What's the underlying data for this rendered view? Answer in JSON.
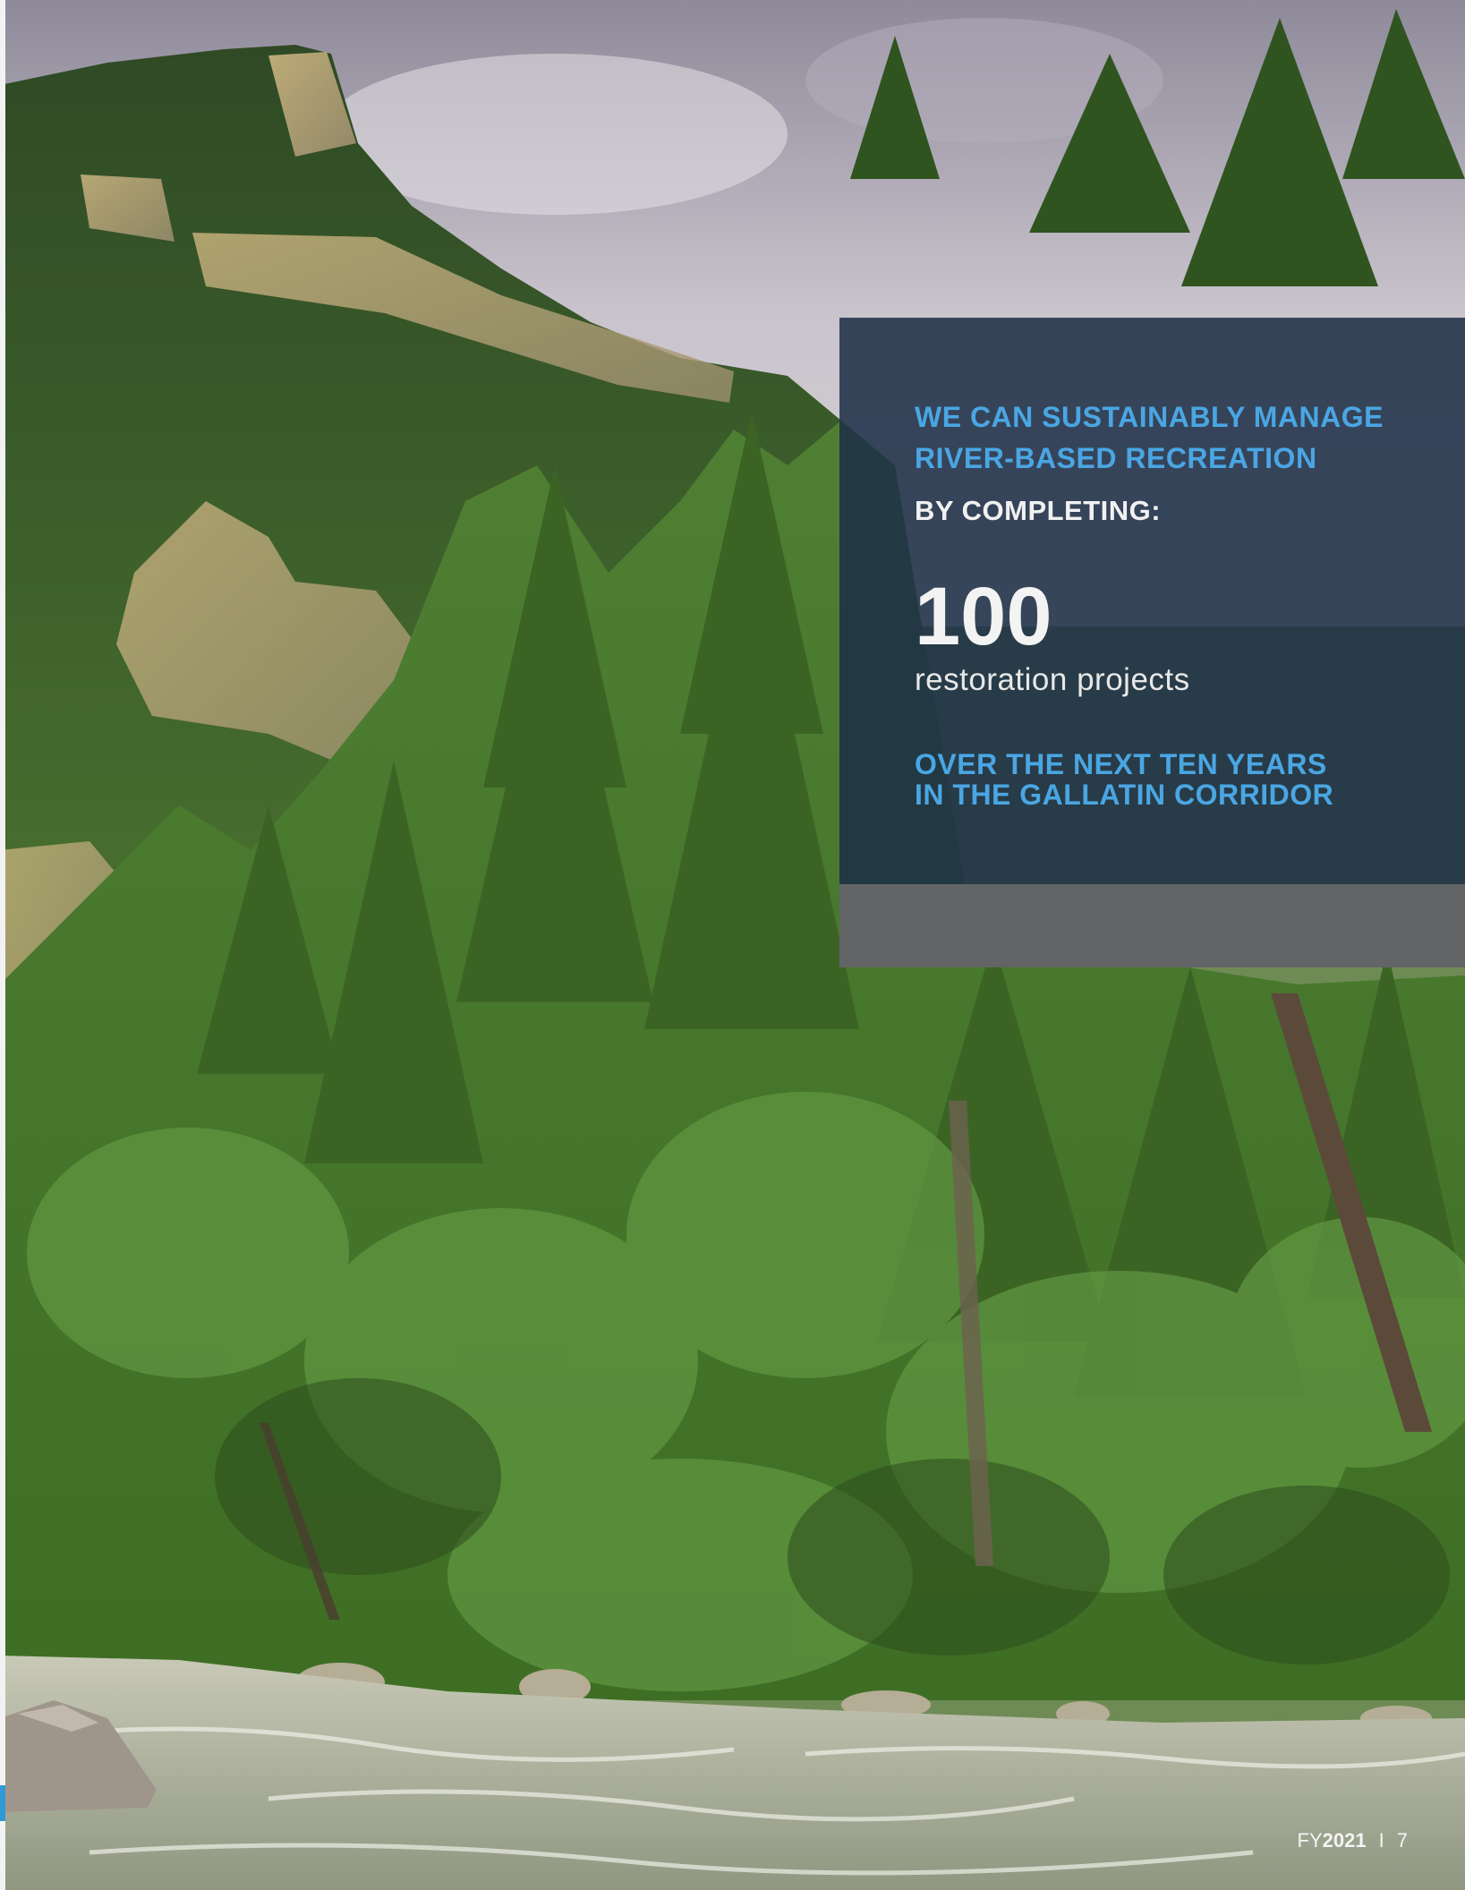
{
  "panel": {
    "headline_line1": "WE CAN SUSTAINABLY MANAGE",
    "headline_line2": "RIVER-BASED RECREATION",
    "subhead": "BY COMPLETING:",
    "number": "100",
    "metric_label": "restoration projects",
    "timeframe_line1": "OVER THE NEXT TEN YEARS",
    "timeframe_line2": "IN THE GALLATIN CORRIDOR"
  },
  "footer": {
    "prefix": "FY",
    "year": "2021",
    "separator": "I",
    "page_number": "7"
  },
  "colors": {
    "accent_blue": "#4aa6e3",
    "panel_navy": "#1c2d46",
    "panel_footer_gray": "#636466",
    "forest_green": "#3f6a2a"
  }
}
